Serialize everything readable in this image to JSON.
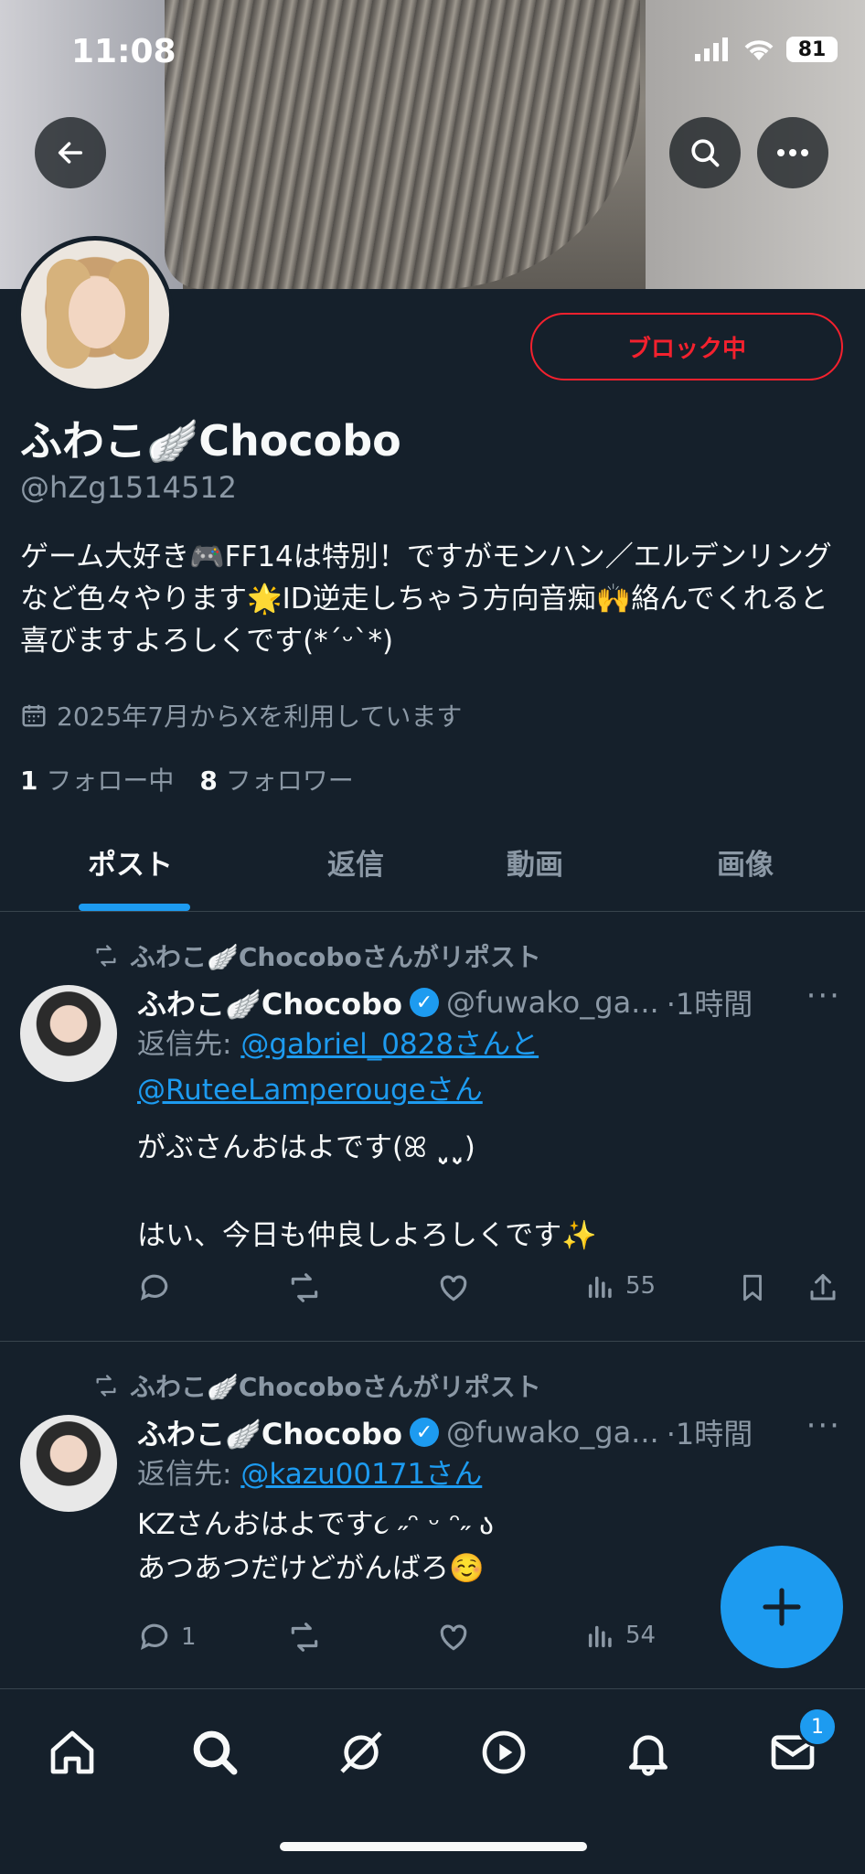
{
  "status_bar": {
    "time": "11:08",
    "battery": "81"
  },
  "profile": {
    "display_name": "ふわこ🪽Chocobo",
    "handle": "@hZg1514512",
    "bio": "ゲーム大好き🎮FF14は特別！ですがモンハン／エルデンリングなど色々やります🌟ID逆走しちゃう方向音痴🙌絡んでくれると喜びますよろしくです(*ˊᵕˋ*)",
    "joined": "2025年7月からXを利用しています",
    "following_count": "1",
    "following_label": "フォロー中",
    "followers_count": "8",
    "followers_label": "フォロワー",
    "block_button": "ブロック中"
  },
  "tabs": [
    {
      "label": "ポスト",
      "active": true
    },
    {
      "label": "返信"
    },
    {
      "label": "動画"
    },
    {
      "label": "画像"
    }
  ],
  "posts": [
    {
      "repost_label": "ふわこ🪽Chocoboさんがリポスト",
      "name": "ふわこ🪽Chocobo",
      "handle": "@fuwako_ga...",
      "time": "·1時間",
      "reply_prefix": "返信先: ",
      "reply_to": "@gabriel_0828さんと",
      "reply_to_2": "@RuteeLamperougeさん",
      "text": "がぶさんおはよです(ꕤ ˬ̤̮ˬ̤̮)\n\nはい、今日も仲良しよろしくです✨",
      "replies": "",
      "views": "55"
    },
    {
      "repost_label": "ふわこ🪽Chocoboさんがリポスト",
      "name": "ふわこ🪽Chocobo",
      "handle": "@fuwako_ga...",
      "time": "·1時間",
      "reply_prefix": "返信先: ",
      "reply_to": "@kazu00171さん",
      "text": "KZさんおはよです૮ ˶ᵔ ᵕ ᵔ˶ ა\nあつあつだけどがんばろ☺️",
      "replies": "1",
      "views": "54"
    }
  ],
  "bottom_nav": {
    "messages_badge": "1"
  },
  "icons": [
    "back-arrow-icon",
    "search-icon",
    "more-icon",
    "calendar-icon",
    "repost-icon",
    "verified-icon",
    "reply-icon",
    "like-icon",
    "views-icon",
    "bookmark-icon",
    "share-icon",
    "plus-icon",
    "home-icon",
    "grok-icon",
    "play-icon",
    "bell-icon",
    "mail-icon"
  ],
  "colors": {
    "background": "#15202b",
    "accent": "#1d9bf0",
    "danger": "#f4212e",
    "muted": "#8b98a5"
  }
}
